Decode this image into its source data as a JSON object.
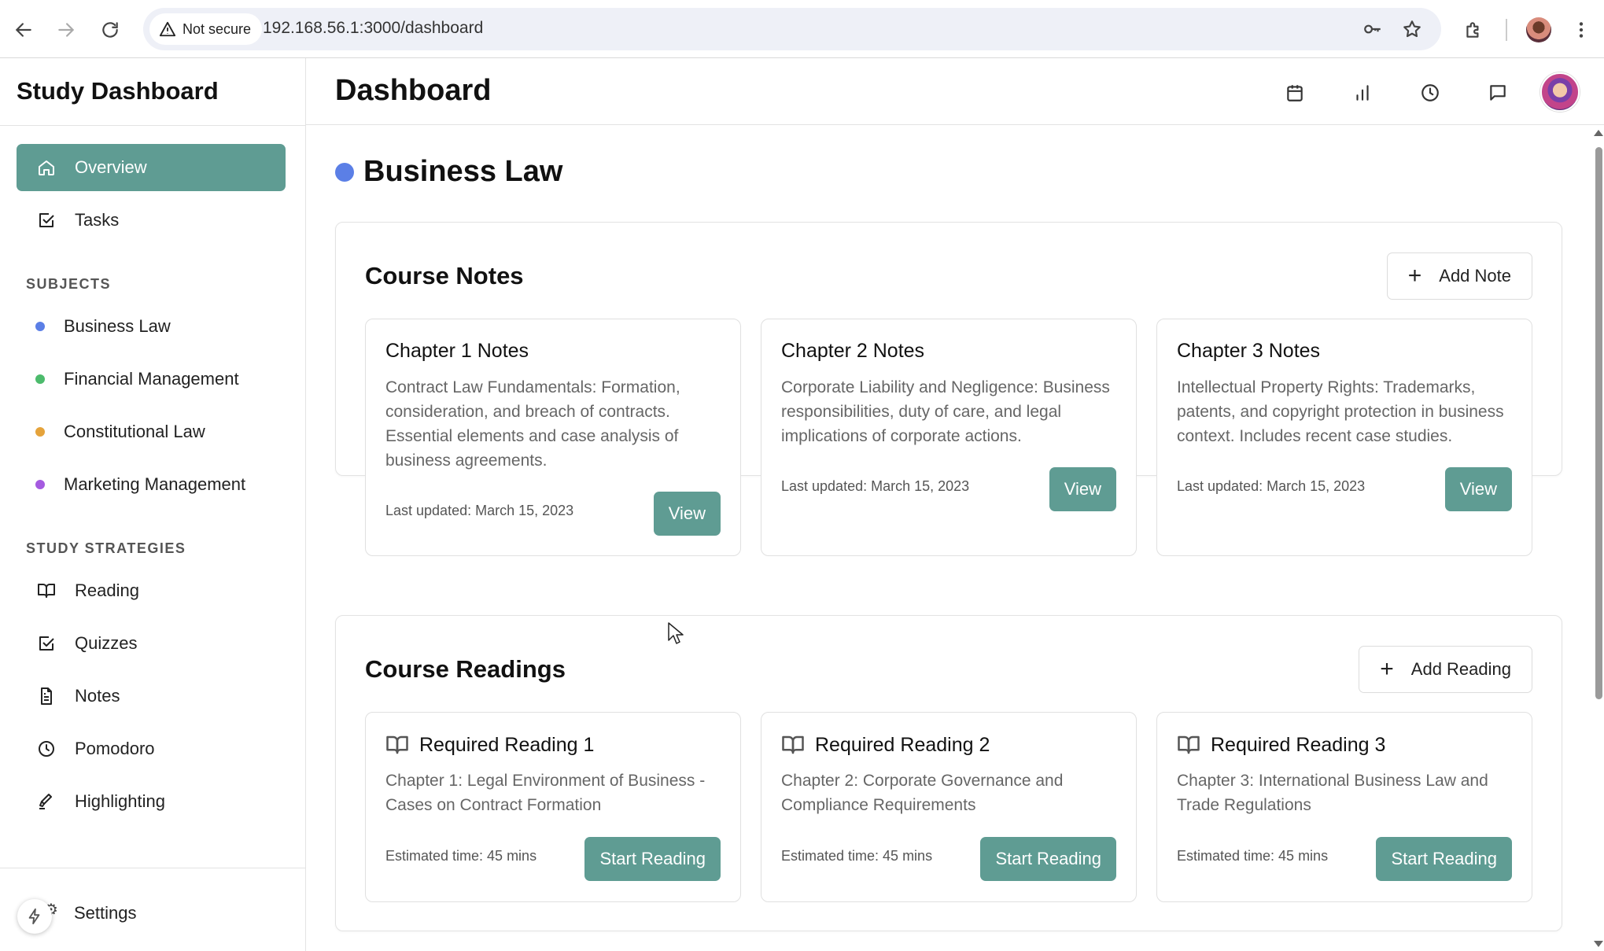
{
  "browser": {
    "security_label": "Not secure",
    "url": "192.168.56.1:3000/dashboard",
    "icons": [
      "back-icon",
      "forward-icon",
      "reload-icon",
      "warning-icon",
      "key-icon",
      "star-icon",
      "extensions-icon",
      "profile-avatar",
      "more-icon"
    ]
  },
  "sidebar": {
    "brand": "Study Dashboard",
    "main_items": [
      {
        "label": "Overview",
        "icon": "home-icon",
        "active": true
      },
      {
        "label": "Tasks",
        "icon": "checkbox-icon",
        "active": false
      }
    ],
    "subjects_heading": "SUBJECTS",
    "subjects": [
      {
        "label": "Business Law",
        "color": "#5b7fe6"
      },
      {
        "label": "Financial Management",
        "color": "#4cbb6c"
      },
      {
        "label": "Constitutional Law",
        "color": "#e5a33b"
      },
      {
        "label": "Marketing Management",
        "color": "#a55be0"
      }
    ],
    "strategies_heading": "STUDY STRATEGIES",
    "strategies": [
      {
        "label": "Reading",
        "icon": "book-icon"
      },
      {
        "label": "Quizzes",
        "icon": "checkbox-icon"
      },
      {
        "label": "Notes",
        "icon": "document-icon"
      },
      {
        "label": "Pomodoro",
        "icon": "clock-icon"
      },
      {
        "label": "Highlighting",
        "icon": "highlighter-icon"
      }
    ],
    "settings_label": "Settings"
  },
  "header": {
    "title": "Dashboard",
    "icons": [
      "calendar-icon",
      "bar-chart-icon",
      "clock-icon",
      "message-icon",
      "user-avatar"
    ]
  },
  "main": {
    "subject_title": "Business Law",
    "subject_color": "#5b7fe6",
    "notes_section": {
      "title": "Course Notes",
      "add_label": "Add Note",
      "cards": [
        {
          "title": "Chapter 1 Notes",
          "desc": "Contract Law Fundamentals: Formation, consideration, and breach of contracts. Essential elements and case analysis of business agreements.",
          "meta": "Last updated: March 15, 2023",
          "button": "View"
        },
        {
          "title": "Chapter 2 Notes",
          "desc": "Corporate Liability and Negligence: Business responsibilities, duty of care, and legal implications of corporate actions.",
          "meta": "Last updated: March 15, 2023",
          "button": "View"
        },
        {
          "title": "Chapter 3 Notes",
          "desc": "Intellectual Property Rights: Trademarks, patents, and copyright protection in business context. Includes recent case studies.",
          "meta": "Last updated: March 15, 2023",
          "button": "View"
        }
      ]
    },
    "readings_section": {
      "title": "Course Readings",
      "add_label": "Add Reading",
      "cards": [
        {
          "title": "Required Reading 1",
          "desc": "Chapter 1: Legal Environment of Business - Cases on Contract Formation",
          "meta": "Estimated time: 45 mins",
          "button": "Start Reading"
        },
        {
          "title": "Required Reading 2",
          "desc": "Chapter 2: Corporate Governance and Compliance Requirements",
          "meta": "Estimated time: 45 mins",
          "button": "Start Reading"
        },
        {
          "title": "Required Reading 3",
          "desc": "Chapter 3: International Business Law and Trade Regulations",
          "meta": "Estimated time: 45 mins",
          "button": "Start Reading"
        }
      ]
    }
  },
  "colors": {
    "accent": "#5f9c93",
    "border": "#e3e3e3"
  }
}
